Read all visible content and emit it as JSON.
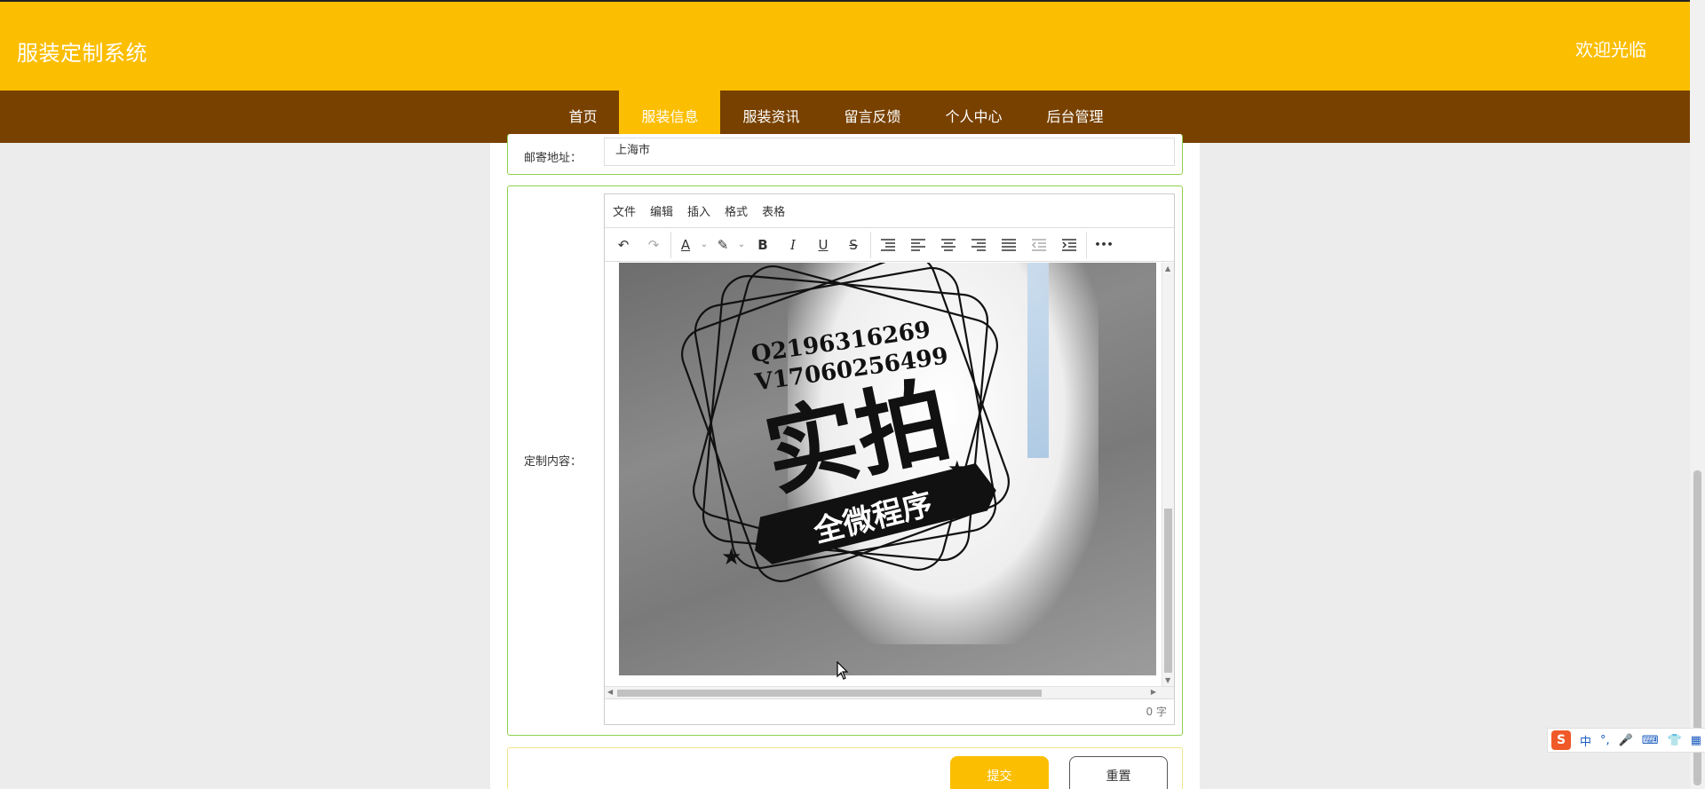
{
  "header": {
    "title": "服装定制系统",
    "welcome": "欢迎光临"
  },
  "nav": {
    "items": [
      {
        "label": "首页"
      },
      {
        "label": "服装信息",
        "active": true
      },
      {
        "label": "服装资讯"
      },
      {
        "label": "留言反馈"
      },
      {
        "label": "个人中心"
      },
      {
        "label": "后台管理"
      }
    ]
  },
  "form": {
    "address_label": "邮寄地址：",
    "address_value": "上海市",
    "content_label": "定制内容："
  },
  "editor": {
    "menus": [
      "文件",
      "编辑",
      "插入",
      "格式",
      "表格"
    ],
    "tools": {
      "undo": "↶",
      "redo": "↷",
      "font_color": "A",
      "bg_color": "✎",
      "bold": "B",
      "italic": "I",
      "underline": "U",
      "strike": "S",
      "more": "•••"
    },
    "word_count": "0 字",
    "watermark": {
      "line1": "Q2196316269",
      "line2": "V17060256499",
      "big": "实拍",
      "banner": "全微程序"
    }
  },
  "buttons": {
    "submit": "提交",
    "reset": "重置"
  },
  "ime": {
    "logo": "S",
    "lang": "中",
    "punct": "°,",
    "mic": "🎤",
    "keyboard": "⌨",
    "skin": "👕",
    "grid": "▦"
  },
  "colors": {
    "header": "#fcbe00",
    "nav": "#784100",
    "accent": "#fcbe00"
  }
}
